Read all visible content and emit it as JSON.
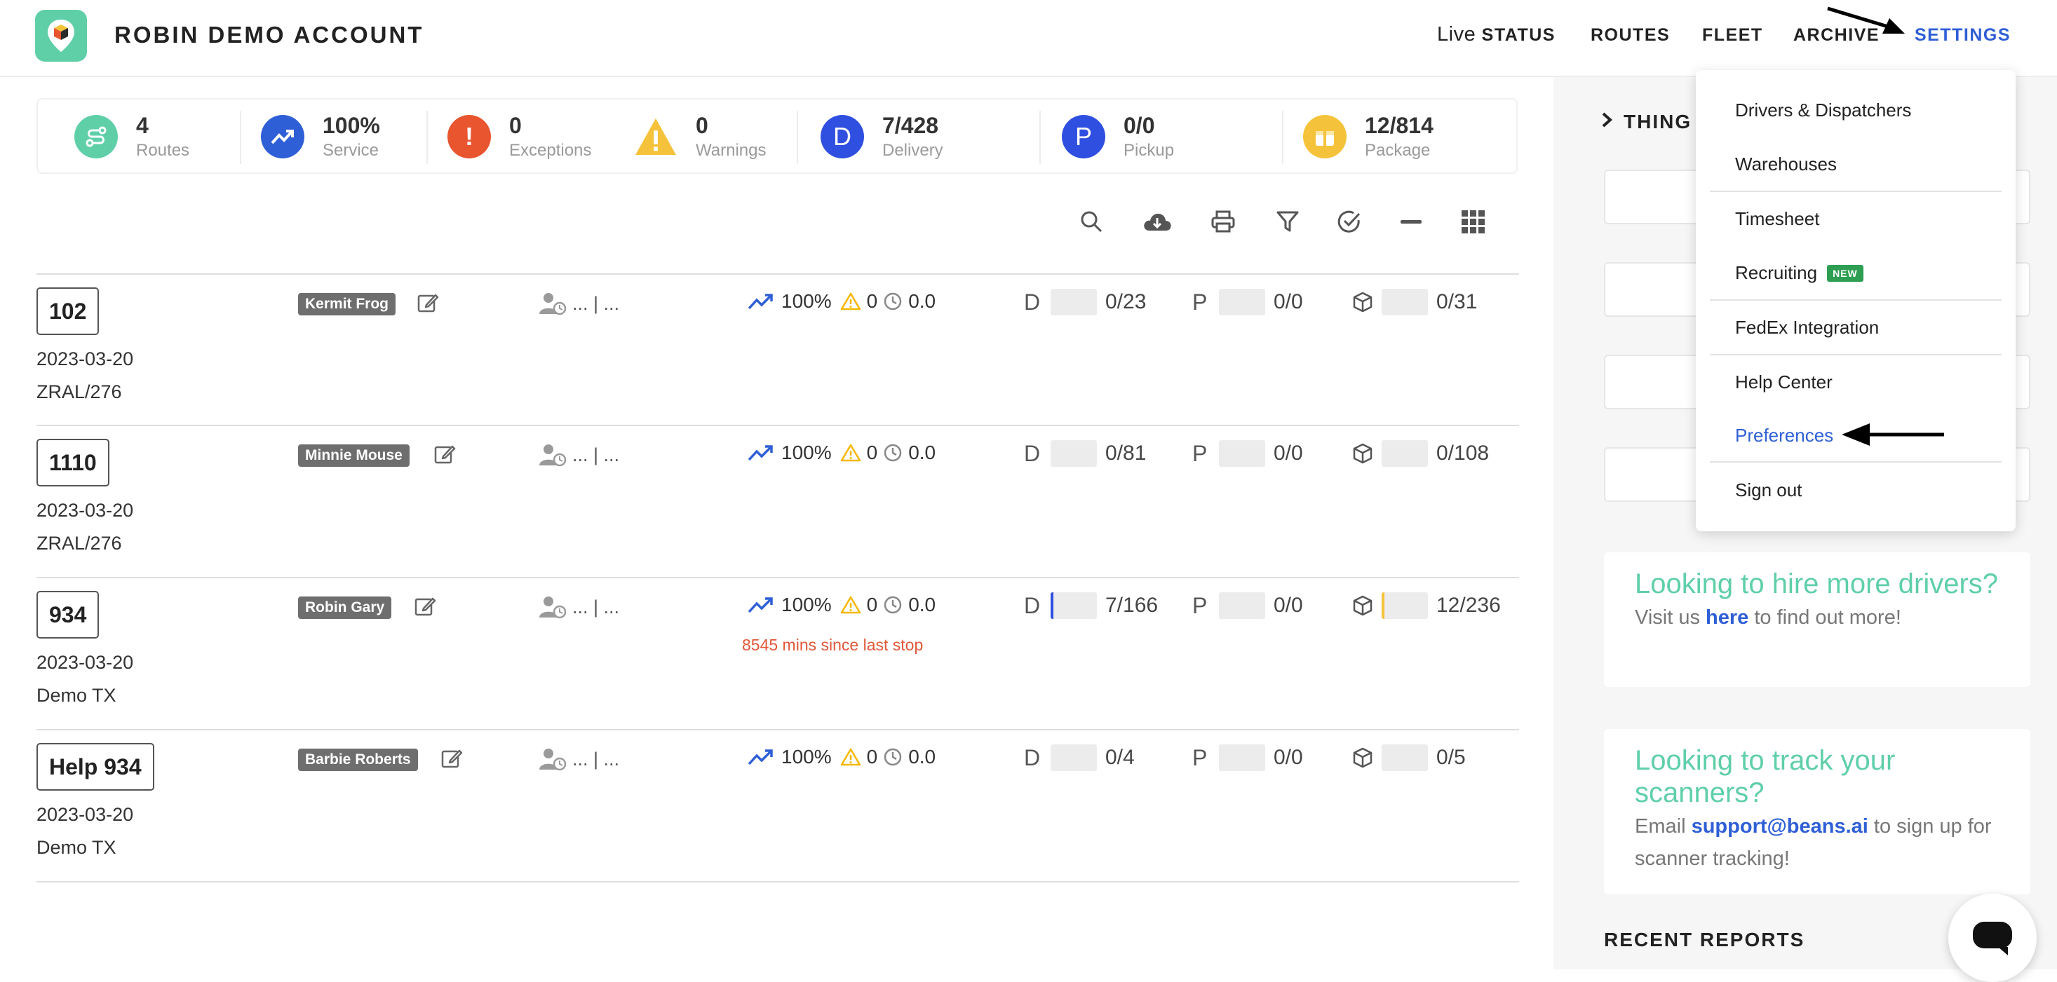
{
  "app": {
    "title": "ROBIN DEMO ACCOUNT"
  },
  "nav": {
    "live_prefix": "Live",
    "live_status": "STATUS",
    "routes": "ROUTES",
    "fleet": "FLEET",
    "archive": "ARCHIVE",
    "settings": "SETTINGS"
  },
  "stats": [
    {
      "value": "4",
      "label": "Routes",
      "color": "#5fcfa8",
      "icon": "route-icon"
    },
    {
      "value": "100%",
      "label": "Service",
      "color": "#2f5fd6",
      "icon": "trend-up-icon"
    },
    {
      "value": "0",
      "label": "Exceptions",
      "color": "#e8552f",
      "icon": "exclamation-icon"
    },
    {
      "value": "0",
      "label": "Warnings",
      "color": "#f5c33b",
      "icon": "warning-icon"
    },
    {
      "value": "7/428",
      "label": "Delivery",
      "color": "#2f4fe0",
      "icon": "D"
    },
    {
      "value": "0/0",
      "label": "Pickup",
      "color": "#2f4fe0",
      "icon": "P"
    },
    {
      "value": "12/814",
      "label": "Package",
      "color": "#f5c33b",
      "icon": "package-icon"
    }
  ],
  "toolbar": [
    "search-icon",
    "cloud-download-icon",
    "print-icon",
    "filter-icon",
    "check-circle-icon",
    "minus-icon",
    "grid-icon"
  ],
  "routes": [
    {
      "id": "102",
      "date": "2023-03-20",
      "location": "ZRAL/276",
      "driver": "Kermit Frog",
      "persons": "... | ...",
      "service": "100%",
      "warnings": "0",
      "time": "0.0",
      "since": "",
      "delivery": "0/23",
      "pickup": "0/0",
      "package": "0/31",
      "delivery_progress": 0,
      "package_progress": 0
    },
    {
      "id": "1110",
      "date": "2023-03-20",
      "location": "ZRAL/276",
      "driver": "Minnie Mouse",
      "persons": "... | ...",
      "service": "100%",
      "warnings": "0",
      "time": "0.0",
      "since": "",
      "delivery": "0/81",
      "pickup": "0/0",
      "package": "0/108",
      "delivery_progress": 0,
      "package_progress": 0
    },
    {
      "id": "934",
      "date": "2023-03-20",
      "location": "Demo TX",
      "driver": "Robin Gary",
      "persons": "... | ...",
      "service": "100%",
      "warnings": "0",
      "time": "0.0",
      "since": "8545 mins since last stop",
      "delivery": "7/166",
      "pickup": "0/0",
      "package": "12/236",
      "delivery_progress": 0.04,
      "package_progress": 0.05
    },
    {
      "id": "Help 934",
      "date": "2023-03-20",
      "location": "Demo TX",
      "driver": "Barbie Roberts",
      "persons": "... | ...",
      "service": "100%",
      "warnings": "0",
      "time": "0.0",
      "since": "",
      "delivery": "0/4",
      "pickup": "0/0",
      "package": "0/5",
      "delivery_progress": 0,
      "package_progress": 0
    }
  ],
  "letters": {
    "delivery": "D",
    "pickup": "P"
  },
  "right_panel": {
    "things_label": "THING",
    "promo1": {
      "heading": "Looking to hire more drivers?",
      "text_before": "Visit us",
      "link": "here",
      "text_after": "to find out more!"
    },
    "promo2": {
      "heading": "Looking to track your scanners?",
      "text_before": "Email",
      "link": "support@beans.ai",
      "text_after": "to sign up for scanner tracking!"
    },
    "recent_reports": "RECENT REPORTS"
  },
  "dropdown": {
    "items": [
      {
        "label": "Drivers & Dispatchers"
      },
      {
        "label": "Warehouses"
      },
      {
        "label": "Timesheet"
      },
      {
        "label": "Recruiting",
        "badge": "NEW"
      },
      {
        "label": "FedEx Integration"
      },
      {
        "label": "Help Center"
      },
      {
        "label": "Preferences",
        "active": true
      },
      {
        "label": "Sign out"
      }
    ]
  },
  "colors": {
    "accent": "#2f5fd6",
    "brand": "#5fcfa8",
    "delivery_fill": "#2f4fe0",
    "package_fill": "#f5c33b"
  }
}
